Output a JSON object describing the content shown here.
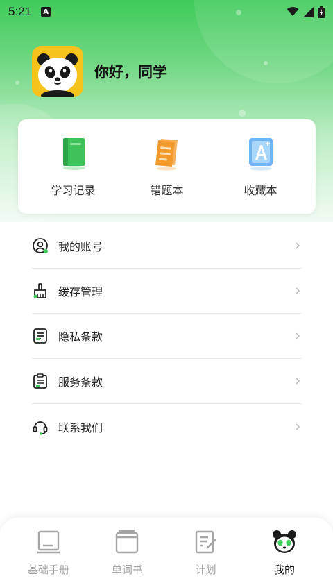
{
  "status_bar": {
    "time": "5:21",
    "app_icon_letter": "A",
    "icons": [
      "wifi-icon",
      "signal-icon",
      "battery-icon"
    ]
  },
  "profile": {
    "greeting": "你好，同学"
  },
  "shortcuts": [
    {
      "label": "学习记录",
      "icon": "green-book-icon"
    },
    {
      "label": "错题本",
      "icon": "orange-notebook-icon"
    },
    {
      "label": "收藏本",
      "icon": "blue-letter-a-icon"
    }
  ],
  "menu": [
    {
      "label": "我的账号",
      "icon": "account-icon"
    },
    {
      "label": "缓存管理",
      "icon": "broom-icon"
    },
    {
      "label": "隐私条款",
      "icon": "document-icon"
    },
    {
      "label": "服务条款",
      "icon": "clipboard-icon"
    },
    {
      "label": "联系我们",
      "icon": "headset-icon"
    }
  ],
  "tabs": [
    {
      "label": "基础手册",
      "icon": "handbook-icon",
      "active": false
    },
    {
      "label": "单词书",
      "icon": "wordbook-icon",
      "active": false
    },
    {
      "label": "计划",
      "icon": "plan-icon",
      "active": false
    },
    {
      "label": "我的",
      "icon": "panda-icon",
      "active": true
    }
  ],
  "colors": {
    "brand_green": "#3fcb5a",
    "accent_orange": "#f39a2c",
    "accent_blue": "#5aa9f2",
    "inactive_tab": "#a5a5a5"
  }
}
